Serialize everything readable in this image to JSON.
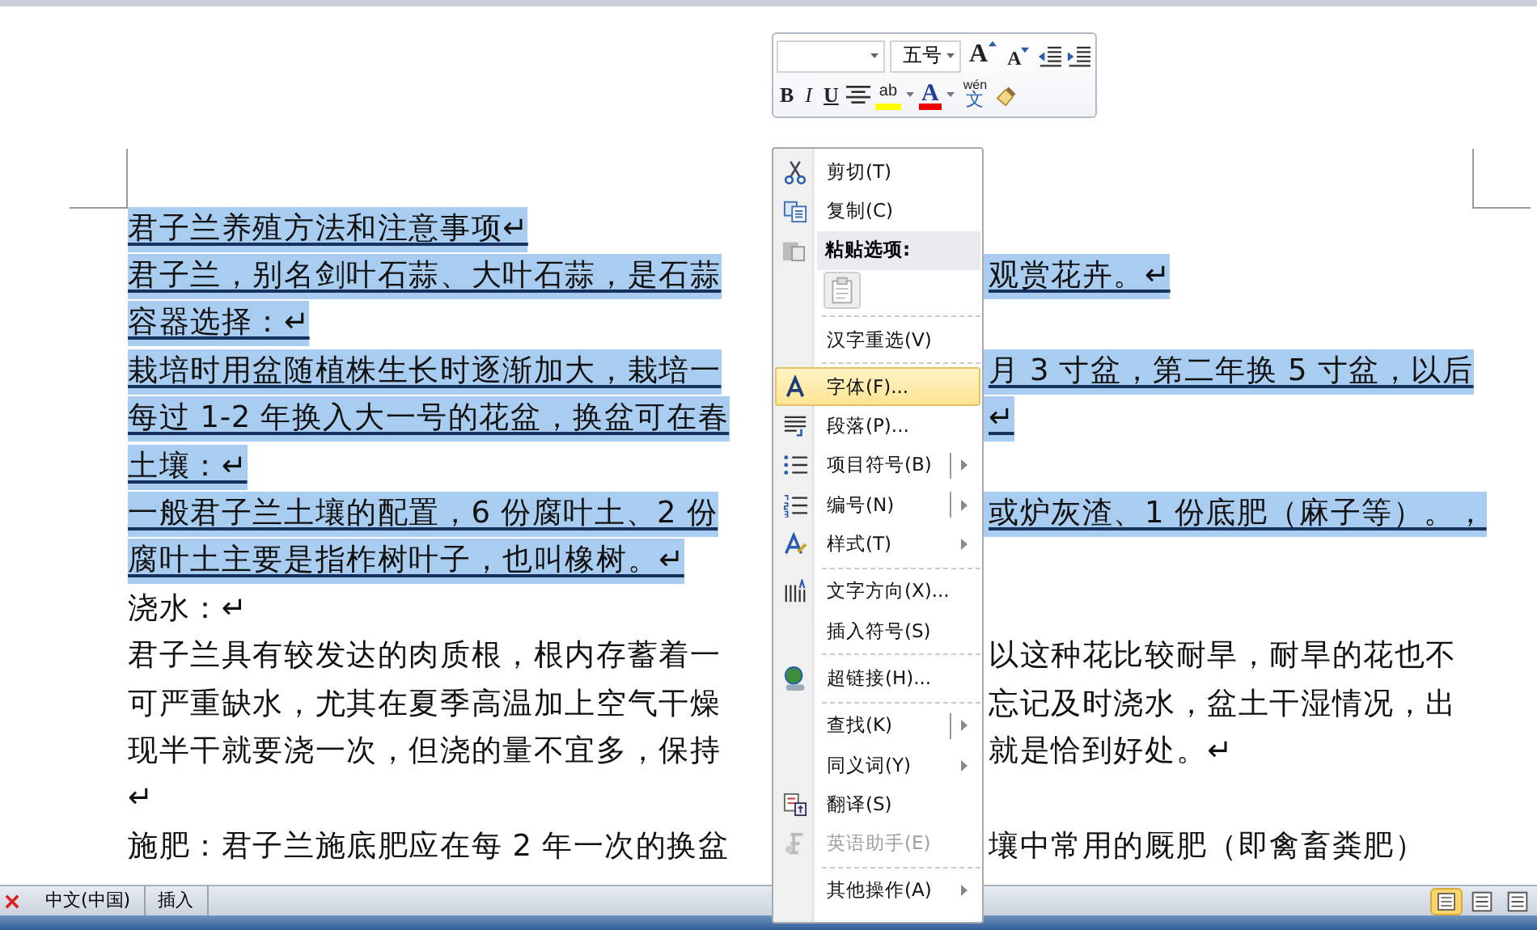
{
  "document": {
    "lines": [
      {
        "left": "君子兰养殖方法和注意事项↵",
        "selected": true
      },
      {
        "left": "君子兰，别名剑叶石蒜、大叶石蒜，是石蒜",
        "right": "观赏花卉。↵",
        "selected": true
      },
      {
        "left": "容器选择：↵",
        "selected": true
      },
      {
        "left": "栽培时用盆随植株生长时逐渐加大，栽培一",
        "right": "月 3 寸盆，第二年换 5 寸盆，以后",
        "selected": true
      },
      {
        "left": "每过 1-2 年换入大一号的花盆，换盆可在春",
        "right": "↵",
        "selected": true
      },
      {
        "left": "土壤：↵",
        "selected": true
      },
      {
        "left": "一般君子兰土壤的配置，6 份腐叶土、2 份",
        "right": "或炉灰渣、1 份底肥（麻子等）。，",
        "selected": true
      },
      {
        "left": "腐叶土主要是指柞树叶子，也叫橡树。↵",
        "selected": true
      },
      {
        "left": "浇水：↵",
        "selected": false
      },
      {
        "left": "君子兰具有较发达的肉质根，根内存蓄着一",
        "right": "以这种花比较耐旱，耐旱的花也不",
        "selected": false
      },
      {
        "left": "可严重缺水，尤其在夏季高温加上空气干燥",
        "right": "忘记及时浇水，盆土干湿情况，出",
        "selected": false
      },
      {
        "left": "现半干就要浇一次，但浇的量不宜多，保持",
        "right": "就是恰到好处。↵",
        "selected": false
      },
      {
        "left": "↵",
        "selected": false
      },
      {
        "left": "施肥：君子兰施底肥应在每 2 年一次的换盆",
        "right": "壤中常用的厩肥（即禽畜粪肥）",
        "selected": false
      }
    ]
  },
  "mini_toolbar": {
    "font_size": "五号",
    "buttons": [
      {
        "kind": "grow",
        "label": "A"
      },
      {
        "kind": "shrink",
        "label": "A"
      },
      {
        "kind": "outdent"
      },
      {
        "kind": "indent"
      },
      {
        "kind": "bold",
        "label": "B"
      },
      {
        "kind": "italic",
        "label": "I"
      },
      {
        "kind": "underline",
        "label": "U"
      },
      {
        "kind": "center"
      },
      {
        "kind": "highlight",
        "label": "ab"
      },
      {
        "kind": "font_color",
        "label": "A"
      },
      {
        "kind": "phonetic",
        "label": "wén",
        "sub": "文"
      },
      {
        "kind": "painter"
      }
    ]
  },
  "context_menu": {
    "items": [
      {
        "kind": "item",
        "label": "剪切(T)",
        "selected": false,
        "disabled": false
      },
      {
        "kind": "item",
        "label": "复制(C)",
        "selected": false,
        "disabled": false
      },
      {
        "kind": "header",
        "label": "粘贴选项:"
      },
      {
        "kind": "paste"
      },
      {
        "kind": "separator"
      },
      {
        "kind": "item",
        "label": "汉字重选(V)",
        "selected": false,
        "disabled": false
      },
      {
        "kind": "separator"
      },
      {
        "kind": "item",
        "label": "字体(F)...",
        "selected": true,
        "disabled": false
      },
      {
        "kind": "item",
        "label": "段落(P)...",
        "selected": false,
        "disabled": false
      },
      {
        "kind": "item",
        "label": "项目符号(B)",
        "selected": false,
        "disabled": false,
        "submenu": true,
        "split": true
      },
      {
        "kind": "item",
        "label": "编号(N)",
        "selected": false,
        "disabled": false,
        "submenu": true,
        "split": true
      },
      {
        "kind": "item",
        "label": "样式(T)",
        "selected": false,
        "disabled": false,
        "submenu": true,
        "split": false
      },
      {
        "kind": "separator"
      },
      {
        "kind": "item",
        "label": "文字方向(X)...",
        "selected": false,
        "disabled": false
      },
      {
        "kind": "item",
        "label": "插入符号(S)",
        "selected": false,
        "disabled": false
      },
      {
        "kind": "separator"
      },
      {
        "kind": "item",
        "label": "超链接(H)...",
        "selected": false,
        "disabled": false
      },
      {
        "kind": "separator"
      },
      {
        "kind": "item",
        "label": "查找(K)",
        "selected": false,
        "disabled": false,
        "submenu": true,
        "split": true
      },
      {
        "kind": "item",
        "label": "同义词(Y)",
        "selected": false,
        "disabled": false,
        "submenu": true,
        "split": false
      },
      {
        "kind": "item",
        "label": "翻译(S)",
        "selected": false,
        "disabled": false
      },
      {
        "kind": "item",
        "label": "英语助手(E)",
        "selected": false,
        "disabled": true
      },
      {
        "kind": "separator"
      },
      {
        "kind": "item",
        "label": "其他操作(A)",
        "selected": false,
        "disabled": false,
        "submenu": true,
        "split": false
      }
    ]
  },
  "status_bar": {
    "language": "中文(中国)",
    "mode": "插入",
    "views": [
      {
        "selected": true
      },
      {
        "selected": false
      },
      {
        "selected": false
      }
    ]
  }
}
